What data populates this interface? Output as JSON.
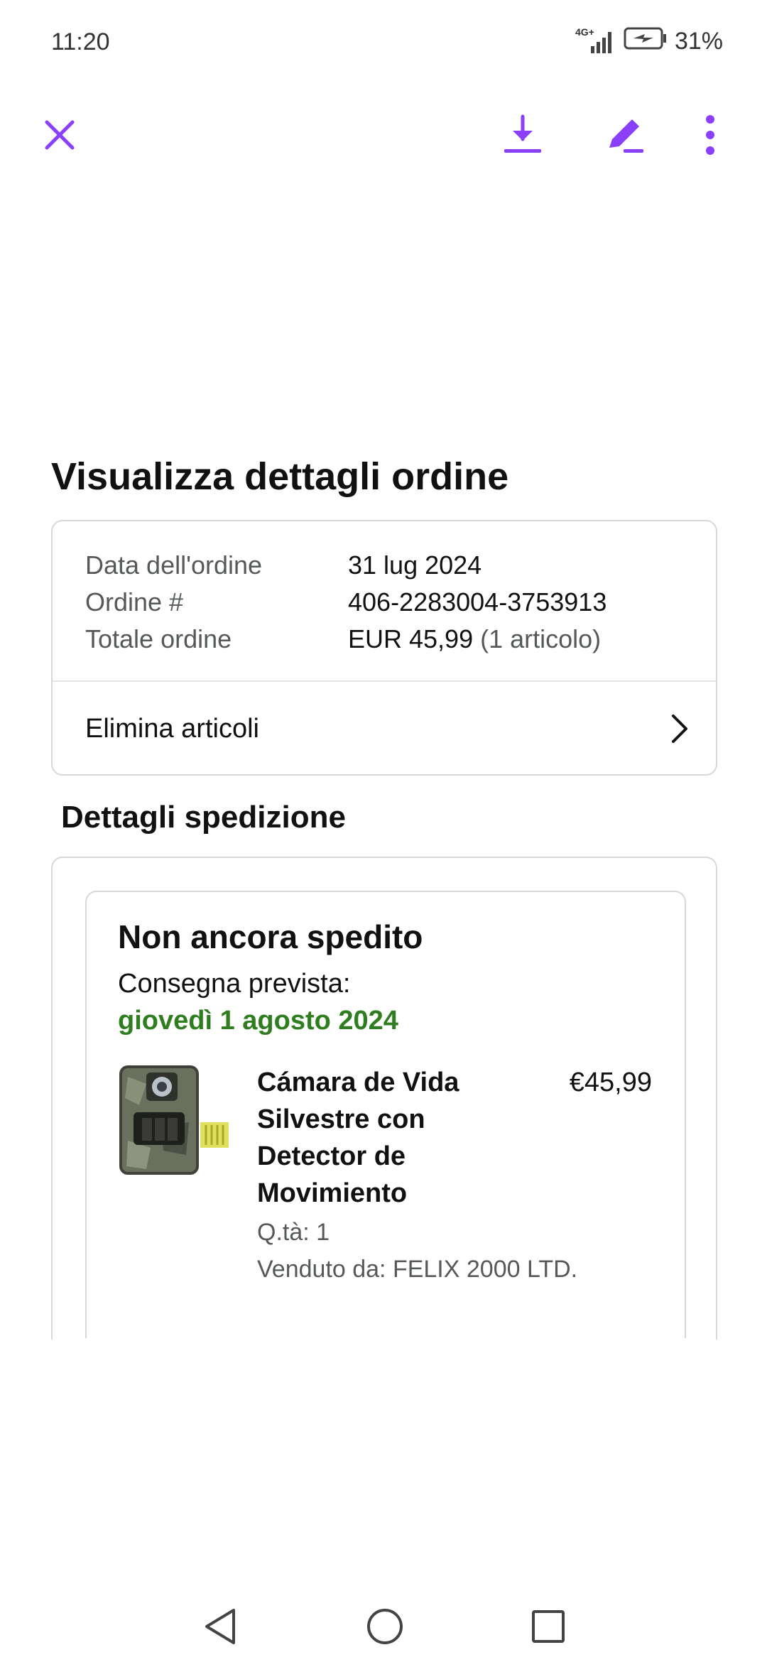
{
  "status_bar": {
    "time": "11:20",
    "network": "4G+",
    "battery": "31%"
  },
  "toolbar": {
    "accent": "#8a3ffc",
    "close_icon": "close-icon",
    "download_icon": "download-icon",
    "edit_icon": "pencil-icon",
    "more_icon": "more-vert-icon"
  },
  "order": {
    "page_title": "Visualizza dettagli ordine",
    "rows": [
      {
        "label": "Data dell'ordine",
        "value": "31 lug 2024",
        "extra": ""
      },
      {
        "label": "Ordine #",
        "value": "406-2283004-3753913",
        "extra": ""
      },
      {
        "label": "Totale ordine",
        "value": "EUR 45,99",
        "extra": " (1 articolo)"
      }
    ],
    "delete_items": "Elimina articoli"
  },
  "shipping": {
    "section_title": "Dettagli spedizione",
    "status": "Non ancora spedito",
    "delivery_label": "Consegna prevista:",
    "delivery_date": "giovedì 1 agosto 2024",
    "delivery_color": "#2e7d1e",
    "product": {
      "name": "Cámara de Vida Silvestre con Detector de Movimiento",
      "price": "€45,99",
      "qty": "Q.tà: 1",
      "seller": "Venduto da: FELIX 2000 LTD."
    }
  },
  "nav": {
    "back_icon": "back-triangle-icon",
    "home_icon": "home-circle-icon",
    "recents_icon": "recents-square-icon"
  }
}
